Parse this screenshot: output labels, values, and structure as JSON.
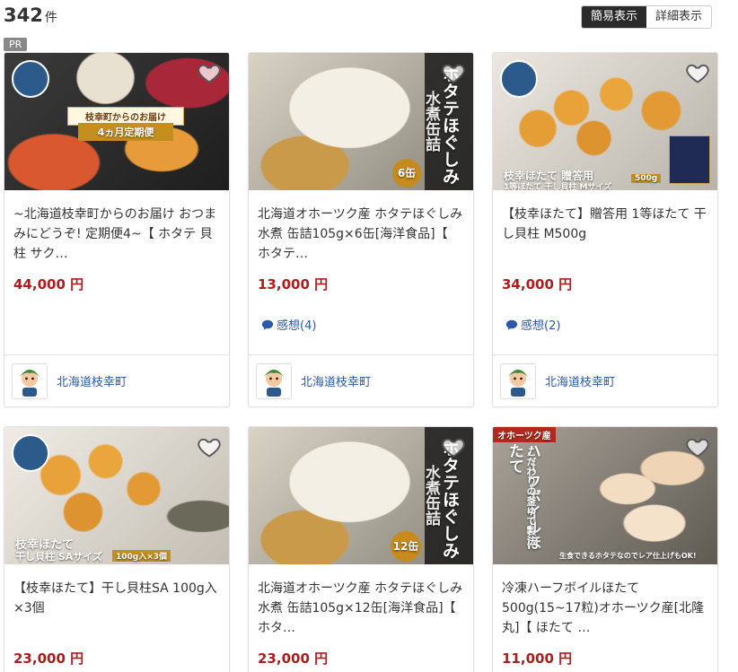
{
  "header": {
    "result_count": "342",
    "result_unit": "件",
    "view_simple": "簡易表示",
    "view_detail": "詳細表示"
  },
  "pr_label": "PR",
  "colors": {
    "price": "#b01c1c",
    "link": "#2b59a6"
  },
  "products": [
    {
      "title": "~北海道枝幸町からのお届け おつまみにどうぞ! 定期便4~【 ホタテ 貝柱 サク…",
      "price": "44,000 円",
      "review": "",
      "shop": "北海道枝幸町",
      "image_texts": [
        "枝幸町からのお届け",
        "4ヵ月定期便"
      ]
    },
    {
      "title": "北海道オホーツク産 ホタテほぐしみ水煮 缶詰105g×6缶[海洋食品]【 ホタテ…",
      "price": "13,000 円",
      "review": "感想(4)",
      "shop": "北海道枝幸町",
      "image_texts": [
        "ホタテほぐしみ",
        "水煮缶詰",
        "6缶"
      ]
    },
    {
      "title": "【枝幸ほたて】贈答用 1等ほたて 干し貝柱 M500g",
      "price": "34,000 円",
      "review": "感想(2)",
      "shop": "北海道枝幸町",
      "image_texts": [
        "枝幸ほたて 贈答用",
        "1等ほたて 干し貝柱 Mサイズ",
        "500g"
      ]
    },
    {
      "title": "【枝幸ほたて】干し貝柱SA 100g入×3個",
      "price": "23,000 円",
      "review": "",
      "shop": "",
      "image_texts": [
        "枝幸ほたて",
        "干し貝柱 SAサイズ",
        "100g入×3個"
      ]
    },
    {
      "title": "北海道オホーツク産 ホタテほぐしみ水煮 缶詰105g×12缶[海洋食品]【 ホタ…",
      "price": "23,000 円",
      "review": "",
      "shop": "",
      "image_texts": [
        "ホタテほぐしみ",
        "水煮缶詰",
        "12缶"
      ]
    },
    {
      "title": "冷凍ハーフボイルほたて500g(15~17粒)オホーツク産[北隆丸]【 ほたて …",
      "price": "11,000 円",
      "review": "",
      "shop": "",
      "image_texts": [
        "オホーツク産",
        "ハーフボイルほたて",
        "こだわりの釜ゆで製法",
        "生食できるホタテなのでレア仕上げもOK!"
      ]
    }
  ]
}
